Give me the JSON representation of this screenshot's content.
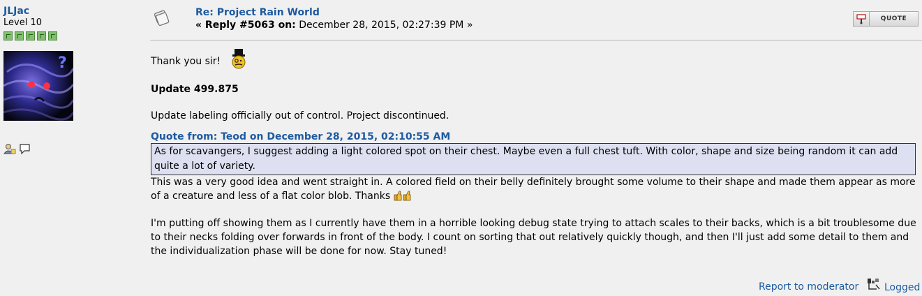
{
  "poster": {
    "name": "JLJac",
    "level": "Level 10",
    "stars": 5
  },
  "post": {
    "subject": "Re: Project Rain World",
    "reply_prefix": "« Reply #5063 on:",
    "reply_date": "December 28, 2015, 02:27:39 PM »",
    "quote_button_label": "QUOTE"
  },
  "body": {
    "greeting": "Thank you sir!",
    "update_title": "Update 499.875",
    "update_text": "Update labeling officially out of control. Project discontinued.",
    "quote_header": "Quote from: Teod on December 28, 2015, 02:10:55 AM",
    "quote_text": "As for scavangers, I suggest adding a light colored spot on their chest. Maybe even a full chest tuft. With color, shape and size being random it can add quite a lot of variety.",
    "reply_para1": "This was a very good idea and went straight in. A colored field on their belly definitely brought some volume to their shape and made them appear as more of a creature and less of a flat color blob. Thanks",
    "reply_para2": "I'm putting off showing them as I currently have them in a horrible looking debug state trying to attach scales to their backs, which is a bit troublesome due to their necks folding over forwards in front of the body. I count on sorting that out relatively quickly though, and then I'll just add some detail to them and the individualization phase will be done for now. Stay tuned!"
  },
  "footer": {
    "report_label": "Report to moderator",
    "logged_label": "Logged"
  },
  "icons": {
    "post": "post-icon",
    "quote": "quote-icon",
    "profile": "profile-icon",
    "message": "message-icon",
    "logged": "ip-logged-icon",
    "smiley": "gentleman-smiley",
    "thumbs": "thumbs-up-smiley"
  }
}
